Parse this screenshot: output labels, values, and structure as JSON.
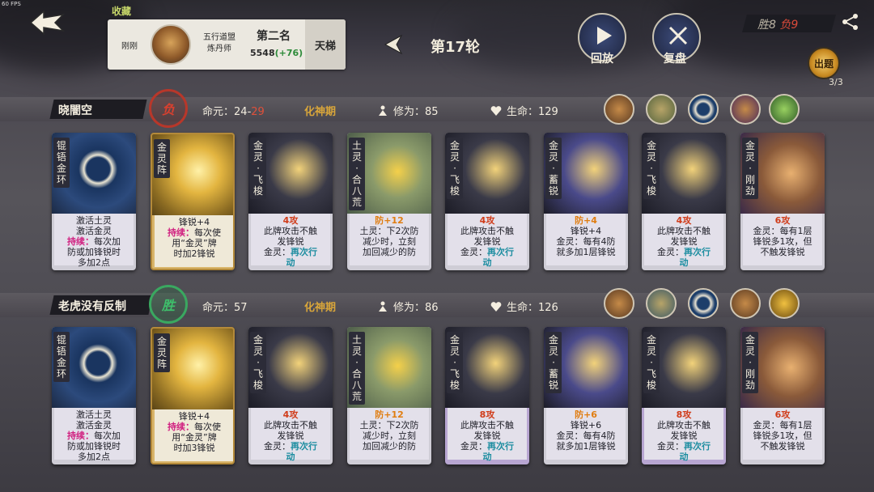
{
  "fps": "60 FPS",
  "header": {
    "collect": "收藏",
    "time": "刚刚",
    "sect_line1": "五行道盟",
    "sect_line2": "炼丹师",
    "rank": "第二名",
    "score": "5548",
    "score_delta": "(+76)",
    "ladder": "天梯",
    "round": "第17轮",
    "replay": "回放",
    "review": "复盘",
    "win_label": "胜8",
    "lose_label": "负9",
    "topic": "出题",
    "topic_count": "3/3"
  },
  "players": [
    {
      "name": "晓闇空",
      "result": "负",
      "life_label": "命元：",
      "life_a": "24",
      "life_sep": "-",
      "life_b": "29",
      "stage": "化神期",
      "cultivation": "修为：85",
      "hp": "生命：129",
      "cards": [
        {
          "name": "锟铻金环",
          "lines": [
            {
              "t": "激活土灵"
            },
            {
              "t": "激活金灵"
            },
            {
              "t": "持续：",
              "c": "hl",
              "r": "每次加"
            },
            {
              "t": "防或加锋锐时"
            },
            {
              "t": "多加2点"
            }
          ]
        },
        {
          "name": "金灵阵",
          "lines": [
            {
              "t": "锋锐+4"
            },
            {
              "t": "持续：",
              "c": "hl",
              "r": "每次使"
            },
            {
              "t": "用“金灵”牌"
            },
            {
              "t": "时加2锋锐"
            }
          ]
        },
        {
          "name": "金灵·飞梭",
          "lines": [
            {
              "t": "4攻",
              "c": "rd"
            },
            {
              "t": "此牌攻击不触"
            },
            {
              "t": "发锋锐"
            },
            {
              "t": "金灵：",
              "r": "再次行",
              "rc": "bl"
            },
            {
              "t": "动",
              "c": "bl"
            }
          ]
        },
        {
          "name": "土灵·合八荒",
          "lines": [
            {
              "t": "防+12",
              "c": "or"
            },
            {
              "t": "土灵：下2次防"
            },
            {
              "t": "减少时，立刻"
            },
            {
              "t": "加回减少的防"
            }
          ]
        },
        {
          "name": "金灵·飞梭",
          "lines": [
            {
              "t": "4攻",
              "c": "rd"
            },
            {
              "t": "此牌攻击不触"
            },
            {
              "t": "发锋锐"
            },
            {
              "t": "金灵：",
              "r": "再次行",
              "rc": "bl"
            },
            {
              "t": "动",
              "c": "bl"
            }
          ]
        },
        {
          "name": "金灵·蓄锐",
          "lines": [
            {
              "t": "防+4",
              "c": "or"
            },
            {
              "t": "锋锐+4"
            },
            {
              "t": "金灵：每有4防"
            },
            {
              "t": "就多加1层锋锐"
            }
          ]
        },
        {
          "name": "金灵·飞梭",
          "lines": [
            {
              "t": "4攻",
              "c": "rd"
            },
            {
              "t": "此牌攻击不触"
            },
            {
              "t": "发锋锐"
            },
            {
              "t": "金灵：",
              "r": "再次行",
              "rc": "bl"
            },
            {
              "t": "动",
              "c": "bl"
            }
          ]
        },
        {
          "name": "金灵·刚劲",
          "lines": [
            {
              "t": "6攻",
              "c": "rd"
            },
            {
              "t": "金灵：每有1层"
            },
            {
              "t": "锋锐多1攻，但"
            },
            {
              "t": "不触发锋锐"
            }
          ]
        }
      ]
    },
    {
      "name": "老虎没有反制",
      "result": "胜",
      "life_label": "命元：",
      "life_a": "57",
      "life_sep": "",
      "life_b": "",
      "stage": "化神期",
      "cultivation": "修为：86",
      "hp": "生命：126",
      "cards": [
        {
          "name": "锟铻金环",
          "lines": [
            {
              "t": "激活土灵"
            },
            {
              "t": "激活金灵"
            },
            {
              "t": "持续：",
              "c": "hl",
              "r": "每次加"
            },
            {
              "t": "防或加锋锐时"
            },
            {
              "t": "多加2点"
            }
          ]
        },
        {
          "name": "金灵阵",
          "lines": [
            {
              "t": "锋锐+4"
            },
            {
              "t": "持续：",
              "c": "hl",
              "r": "每次使"
            },
            {
              "t": "用“金灵”牌"
            },
            {
              "t": "时加3锋锐"
            }
          ]
        },
        {
          "name": "金灵·飞梭",
          "lines": [
            {
              "t": "4攻",
              "c": "rd"
            },
            {
              "t": "此牌攻击不触"
            },
            {
              "t": "发锋锐"
            },
            {
              "t": "金灵：",
              "r": "再次行",
              "rc": "bl"
            },
            {
              "t": "动",
              "c": "bl"
            }
          ]
        },
        {
          "name": "土灵·合八荒",
          "lines": [
            {
              "t": "防+12",
              "c": "or"
            },
            {
              "t": "土灵：下2次防"
            },
            {
              "t": "减少时，立刻"
            },
            {
              "t": "加回减少的防"
            }
          ]
        },
        {
          "name": "金灵·飞梭",
          "lines": [
            {
              "t": "8攻",
              "c": "rd"
            },
            {
              "t": "此牌攻击不触"
            },
            {
              "t": "发锋锐"
            },
            {
              "t": "金灵：",
              "r": "再次行",
              "rc": "bl"
            },
            {
              "t": "动",
              "c": "bl"
            }
          ]
        },
        {
          "name": "金灵·蓄锐",
          "lines": [
            {
              "t": "防+6",
              "c": "or"
            },
            {
              "t": "锋锐+6"
            },
            {
              "t": "金灵：每有4防"
            },
            {
              "t": "就多加1层锋锐"
            }
          ]
        },
        {
          "name": "金灵·飞梭",
          "lines": [
            {
              "t": "8攻",
              "c": "rd"
            },
            {
              "t": "此牌攻击不触"
            },
            {
              "t": "发锋锐"
            },
            {
              "t": "金灵：",
              "r": "再次行",
              "rc": "bl"
            },
            {
              "t": "动",
              "c": "bl"
            }
          ]
        },
        {
          "name": "金灵·刚劲",
          "lines": [
            {
              "t": "6攻",
              "c": "rd"
            },
            {
              "t": "金灵：每有1层"
            },
            {
              "t": "锋锐多1攻，但"
            },
            {
              "t": "不触发锋锐"
            }
          ]
        }
      ]
    }
  ]
}
